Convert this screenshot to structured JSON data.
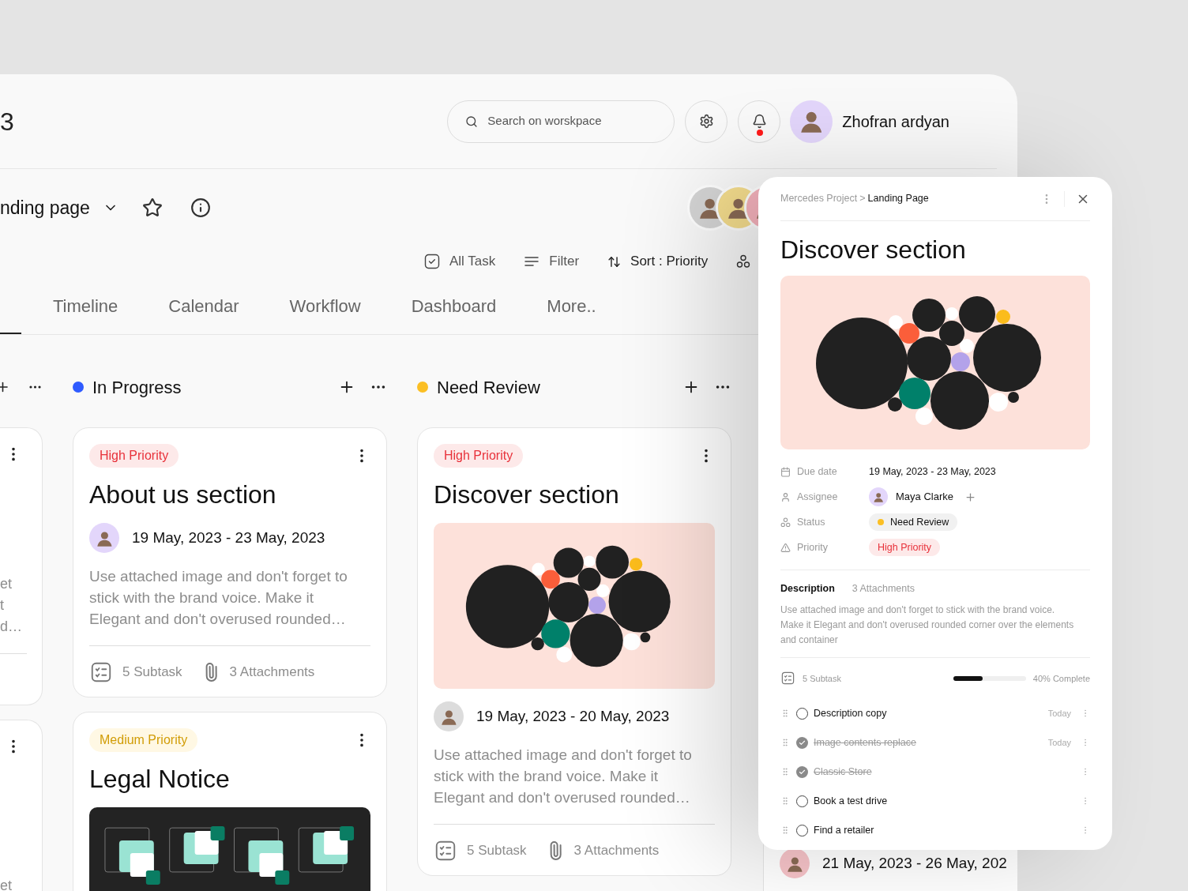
{
  "header": {
    "title": "3",
    "search": {
      "placeholder": "Search on worskpace"
    },
    "notifications": {
      "unread": true
    },
    "user": {
      "name": "Zhofran ardyan"
    }
  },
  "project": {
    "name": "nding page",
    "starred": false
  },
  "toolbar": [
    {
      "kind": "tasks",
      "label": "All Task"
    },
    {
      "kind": "filter",
      "label": "Filter"
    },
    {
      "kind": "sort",
      "label": "Sort : Priority"
    },
    {
      "kind": "group"
    }
  ],
  "tabs": [
    {
      "label": "Timeline",
      "selected": false
    },
    {
      "label": "Calendar",
      "selected": false
    },
    {
      "label": "Workflow",
      "selected": false
    },
    {
      "label": "Dashboard",
      "selected": false
    },
    {
      "label": "More..",
      "selected": false
    }
  ],
  "partial_column": {
    "cards": [
      {
        "fragments": [
          "et",
          "t",
          "d…"
        ]
      },
      {
        "fragments": [
          "et"
        ]
      }
    ]
  },
  "columns": [
    {
      "title": "In Progress",
      "color": "#2f5bff",
      "cards": [
        {
          "kind": "plain",
          "priority": {
            "label": "High Priority",
            "kind": "high"
          },
          "title": "About us section",
          "date": "19 May, 2023 - 23 May, 2023",
          "description": "Use attached image and don't forget to stick with the brand voice. Make it Elegant and don't overused rounded…",
          "subtasks": "5 Subtask",
          "attachments": "3 Attachments"
        },
        {
          "kind": "squares",
          "priority": {
            "label": "Medium Priority",
            "kind": "medium"
          },
          "title": "Legal Notice"
        }
      ]
    },
    {
      "title": "Need Review",
      "color": "#fbbf24",
      "cards": [
        {
          "kind": "bubbles",
          "priority": {
            "label": "High Priority",
            "kind": "high"
          },
          "title": "Discover section",
          "date": "19 May, 2023 - 20 May, 2023",
          "description": "Use attached image and don't forget to stick with the brand voice. Make it Elegant and don't overused rounded…",
          "subtasks": "5 Subtask",
          "attachments": "3 Attachments"
        }
      ]
    }
  ],
  "hidden_card": {
    "date": "21 May, 2023 - 26 May, 202"
  },
  "panel": {
    "breadcrumb": {
      "parent": "Mercedes Project",
      "separator": ">",
      "current": "Landing Page"
    },
    "title": "Discover section",
    "fields": [
      {
        "kind": "date",
        "label": "Due date",
        "value": "19 May, 2023 - 23 May, 2023"
      },
      {
        "kind": "assignee",
        "label": "Assignee",
        "value": "Maya Clarke"
      },
      {
        "kind": "status",
        "label": "Status",
        "value": "Need Review",
        "color": "#fbbf24"
      },
      {
        "kind": "priority",
        "label": "Priority",
        "value": "High Priority"
      }
    ],
    "description": {
      "heading": "Description",
      "attachments": "3 Attachments",
      "text": "Use attached image and don't forget to stick with the brand voice. Make it Elegant and don't overused rounded corner over the elements and container"
    },
    "subtasks": {
      "count": "5 Subtask",
      "level": 0.4,
      "progress_label": "40% Complete",
      "items": [
        {
          "label": "Description copy",
          "checked": false,
          "due": "Today"
        },
        {
          "label": "Image contents replace",
          "checked": true,
          "due": "Today"
        },
        {
          "label": "Classic Store",
          "checked": true
        },
        {
          "label": "Book a test drive",
          "checked": false
        },
        {
          "label": "Find a retailer",
          "checked": false
        }
      ]
    }
  }
}
